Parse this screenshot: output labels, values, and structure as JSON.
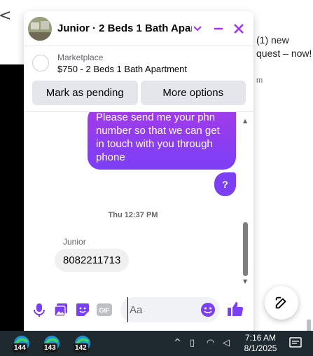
{
  "background": {
    "close_glyph": "<",
    "notification_text": "(1) new quest – now!",
    "notification_time": "m"
  },
  "chat": {
    "title": "Junior · 2 Beds 1 Bath Apar…",
    "marketplace": {
      "label": "Marketplace",
      "listing": "$750 - 2 Beds 1 Bath Apartment",
      "mark_pending_label": "Mark as pending",
      "more_options_label": "More options"
    },
    "messages": {
      "outgoing_text": "Please send me your phn number so that we can get in touch with you through phone",
      "outgoing_question": "?",
      "timestamp": "Thu 12:37 PM",
      "sender_name": "Junior",
      "incoming_text": "8082211713"
    },
    "composer": {
      "placeholder": "Aa",
      "icons": [
        "microphone-icon",
        "photo-icon",
        "sticker-icon",
        "gif-icon",
        "emoji-icon",
        "thumbs-up-icon"
      ],
      "gif_label": "GIF"
    },
    "accent_color": "#a033ff"
  },
  "taskbar": {
    "apps": [
      {
        "badge": "144",
        "icon": "edge-icon"
      },
      {
        "badge": "143",
        "icon": "edge-icon"
      },
      {
        "badge": "142",
        "icon": "edge-icon"
      }
    ],
    "time": "7:16 AM",
    "date": "8/1/2025"
  }
}
